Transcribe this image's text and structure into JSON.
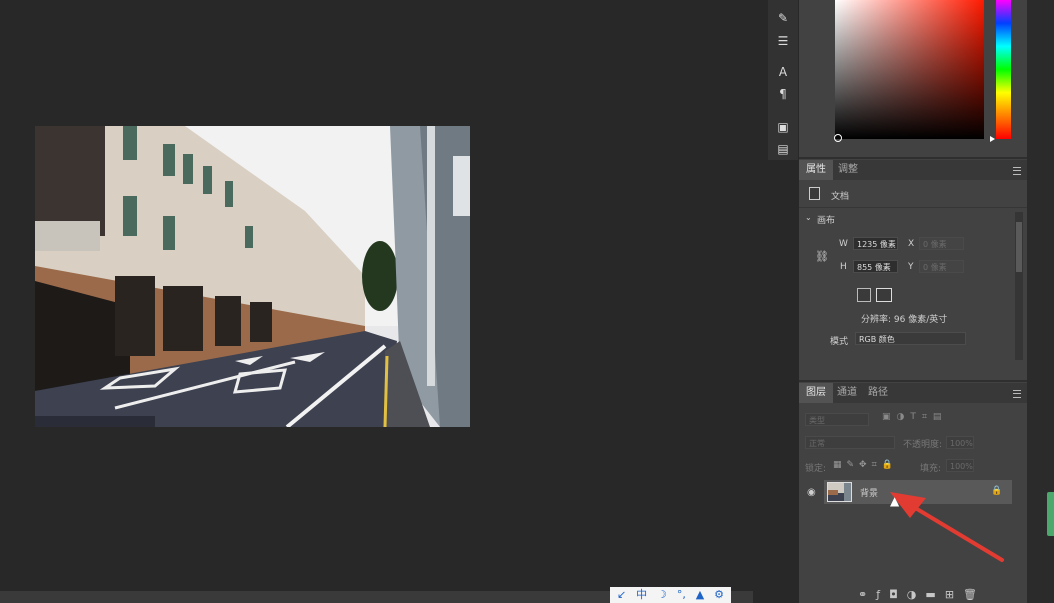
{
  "properties_panel": {
    "tab_properties": "属性",
    "tab_adjustments": "调整",
    "doc_label": "文档",
    "canvas_section": "画布",
    "w_label": "W",
    "w_value": "1235 像素",
    "h_label": "H",
    "h_value": "855 像素",
    "x_label": "X",
    "x_value": "0 像素",
    "y_label": "Y",
    "y_value": "0 像素",
    "resolution": "分辨率: 96 像素/英寸",
    "mode_label": "模式",
    "mode_value": "RGB 颜色"
  },
  "layers_panel": {
    "tab_layers": "图层",
    "tab_channels": "通道",
    "tab_paths": "路径",
    "filter_kind": "类型",
    "blend_mode": "正常",
    "opacity_label": "不透明度:",
    "opacity_value": "100%",
    "lock_label": "锁定:",
    "fill_label": "填充:",
    "fill_value": "100%",
    "layer_name": "背景"
  },
  "ime_bar": {
    "items": [
      "↙",
      "中",
      "☽",
      "°,",
      "▲",
      "⚙"
    ]
  },
  "colors": {
    "accent_red": "#e23b32",
    "panel_bg": "#424242",
    "canvas_bg": "#282828"
  }
}
